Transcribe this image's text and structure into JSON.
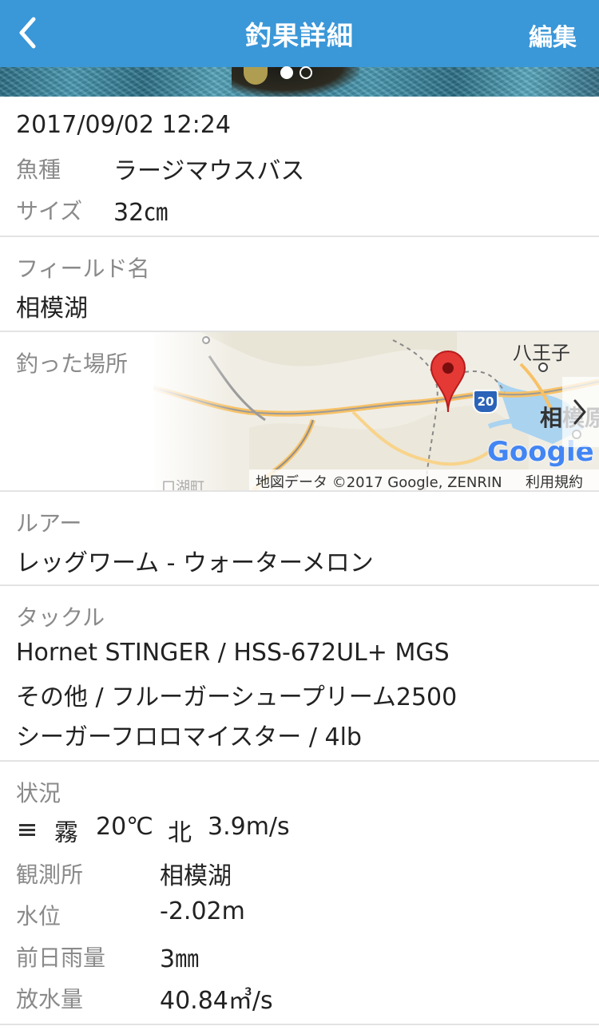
{
  "header": {
    "title": "釣果詳細",
    "edit_label": "編集"
  },
  "photo": {
    "page_count": 2,
    "active_index": 0
  },
  "catch": {
    "datetime": "2017/09/02 12:24",
    "species_label": "魚種",
    "species_value": "ラージマウスバス",
    "size_label": "サイズ",
    "size_value": "32㎝"
  },
  "field": {
    "label": "フィールド名",
    "value": "相模湖"
  },
  "location": {
    "label": "釣った場所",
    "map": {
      "place_label_1": "八王子",
      "place_label_2": "相模原",
      "place_label_3": "口湖町",
      "road_shield": "20",
      "google_logo": "Google",
      "copyright": "地図データ ©2017 Google, ZENRIN",
      "terms": "利用規約"
    }
  },
  "lure": {
    "label": "ルアー",
    "value": "レッグワーム - ウォーターメロン"
  },
  "tackle": {
    "label": "タックル",
    "lines": [
      "Hornet STINGER / HSS-672UL+ MGS",
      "その他 / フルーガーシュープリーム2500",
      "シーガーフロロマイスター / 4lb"
    ]
  },
  "conditions": {
    "label": "状況",
    "weather": "霧",
    "temperature": "20℃",
    "wind_direction": "北",
    "wind_speed": "3.9m/s",
    "rows": [
      {
        "label": "観測所",
        "value": "相模湖"
      },
      {
        "label": "水位",
        "value": "-2.02m"
      },
      {
        "label": "前日雨量",
        "value": "3㎜"
      },
      {
        "label": "放水量",
        "value": "40.84㎥/s"
      }
    ]
  },
  "colors": {
    "header_bg": "#3a97d8",
    "header_text": "#ffffff",
    "label_text": "#8a8a8a",
    "value_text": "#222222",
    "divider": "#e3e3e3",
    "map_pin": "#e53935"
  },
  "icons": {
    "back": "chevron-left-icon",
    "weather": "fog-icon",
    "map_marker": "map-pin-icon",
    "map_expand": "chevron-right-icon"
  }
}
